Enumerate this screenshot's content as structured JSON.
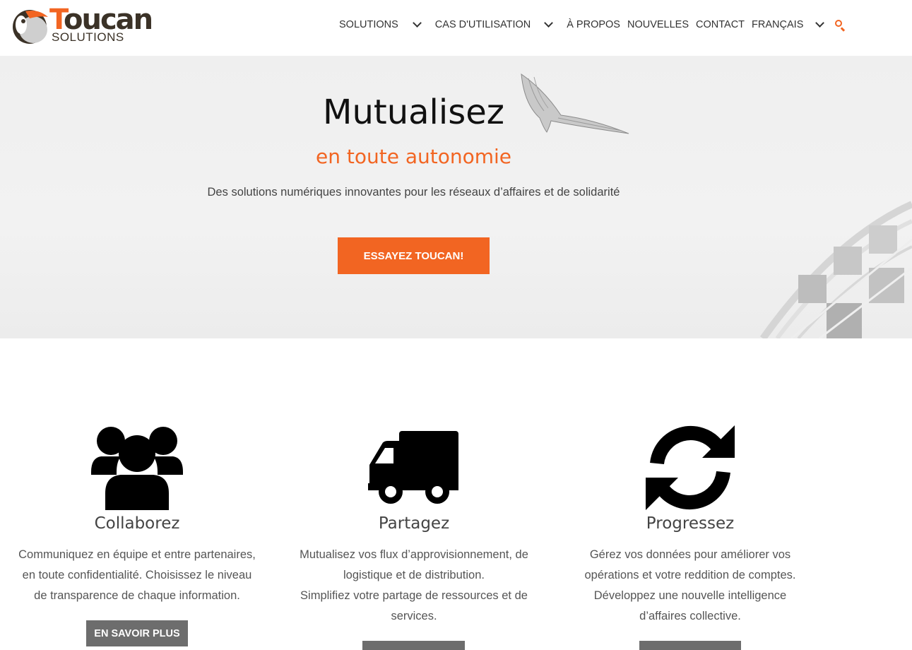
{
  "logo": {
    "word_first": "T",
    "word_rest": "oucan",
    "subtitle": "SOLUTIONS"
  },
  "nav": {
    "items": [
      {
        "label": "SOLUTIONS",
        "has_dropdown": true
      },
      {
        "label": "CAS D'UTILISATION",
        "has_dropdown": true
      },
      {
        "label": "À PROPOS",
        "has_dropdown": false
      },
      {
        "label": "NOUVELLES",
        "has_dropdown": false
      },
      {
        "label": "CONTACT",
        "has_dropdown": false
      },
      {
        "label": "FRANÇAIS",
        "has_dropdown": true
      }
    ],
    "search_icon": "search-icon"
  },
  "hero": {
    "title": "Mutualisez",
    "subtitle": "en toute autonomie",
    "description": "Des solutions numériques innovantes pour les réseaux d’affaires et de solidarité",
    "cta_label": "ESSAYEZ TOUCAN!"
  },
  "features": [
    {
      "icon": "users-icon",
      "title": "Collaborez",
      "text": [
        "Communiquez en équipe et entre partenaires,",
        "en toute confidentialité. Choisissez le niveau",
        "de transparence de chaque information."
      ],
      "button_label": "EN SAVOIR PLUS"
    },
    {
      "icon": "truck-icon",
      "title": "Partagez",
      "text": [
        "Mutualisez vos flux d’approvisionnement, de",
        "logistique et de distribution.",
        "Simplifiez votre partage de ressources et de",
        "services."
      ],
      "button_label": ""
    },
    {
      "icon": "refresh-icon",
      "title": "Progressez",
      "text": [
        "Gérez vos données pour améliorer vos",
        "opérations et votre reddition de comptes.",
        "Développez une nouvelle intelligence",
        "d’affaires collective."
      ],
      "button_label": ""
    }
  ],
  "colors": {
    "accent": "#f26522",
    "dark": "#3b3227",
    "button_gray": "#6d6d6d"
  }
}
